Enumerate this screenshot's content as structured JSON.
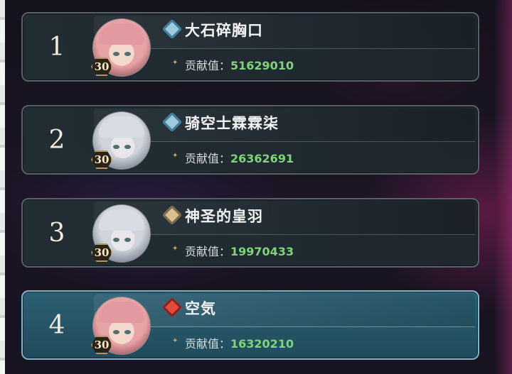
{
  "contribution_label": "贡献值：",
  "entries": [
    {
      "rank": "1",
      "name": "大石碎胸口",
      "level": "30",
      "value": "51629010",
      "element": "ice",
      "avatar": "pink",
      "highlighted": false
    },
    {
      "rank": "2",
      "name": "骑空士霖霖柒",
      "level": "30",
      "value": "26362691",
      "element": "ice",
      "avatar": "silver",
      "highlighted": false
    },
    {
      "rank": "3",
      "name": "神圣的皇羽",
      "level": "30",
      "value": "19970433",
      "element": "earth",
      "avatar": "silver",
      "highlighted": false
    },
    {
      "rank": "4",
      "name": "空気",
      "level": "30",
      "value": "16320210",
      "element": "fire",
      "avatar": "pink",
      "highlighted": true
    }
  ],
  "colors": {
    "value_green": "#7fd47a",
    "highlight_border": "#7fb4c8",
    "highlight_bg": "#2c5f72"
  }
}
